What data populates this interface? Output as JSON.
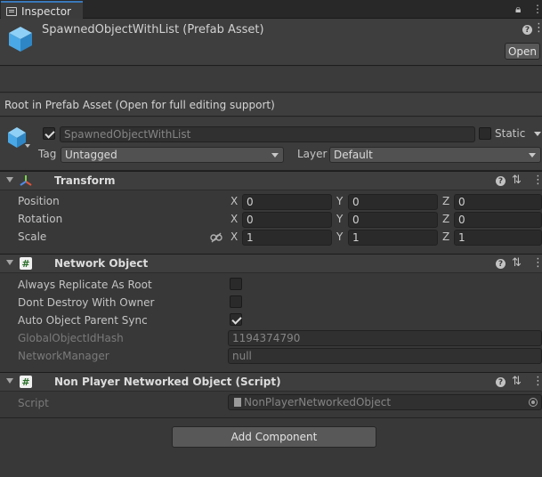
{
  "tab": {
    "label": "Inspector"
  },
  "header": {
    "title": "SpawnedObjectWithList (Prefab Asset)",
    "open_label": "Open"
  },
  "root_message": "Root in Prefab Asset (Open for full editing support)",
  "gameobject": {
    "active": true,
    "name": "SpawnedObjectWithList",
    "static_label": "Static",
    "static_checked": false,
    "tag_label": "Tag",
    "tag_value": "Untagged",
    "layer_label": "Layer",
    "layer_value": "Default"
  },
  "transform": {
    "title": "Transform",
    "rows": [
      {
        "label": "Position",
        "x": "0",
        "y": "0",
        "z": "0"
      },
      {
        "label": "Rotation",
        "x": "0",
        "y": "0",
        "z": "0"
      },
      {
        "label": "Scale",
        "x": "1",
        "y": "1",
        "z": "1"
      }
    ],
    "axis": {
      "x": "X",
      "y": "Y",
      "z": "Z"
    }
  },
  "network_object": {
    "title": "Network Object",
    "fields": {
      "always_replicate": {
        "label": "Always Replicate As Root",
        "checked": false
      },
      "dont_destroy": {
        "label": "Dont Destroy With Owner",
        "checked": false
      },
      "auto_parent": {
        "label": "Auto Object Parent Sync",
        "checked": true
      },
      "hash": {
        "label": "GlobalObjectIdHash",
        "value": "1194374790"
      },
      "manager": {
        "label": "NetworkManager",
        "value": "null"
      }
    }
  },
  "script_component": {
    "title": "Non Player Networked Object (Script)",
    "script_label": "Script",
    "script_value": "NonPlayerNetworkedObject"
  },
  "add_component_label": "Add Component",
  "icons": {
    "tab": "inspector-icon",
    "lock": "lock-icon",
    "menu": "kebab-menu-icon",
    "prefab": "prefab-cube-icon",
    "help": "help-icon",
    "presets": "presets-icon",
    "transform": "transform-axes-icon",
    "script": "cs-script-icon",
    "link": "constrain-proportions-icon"
  },
  "colors": {
    "accent": "#3a79bb",
    "background": "#383838",
    "prefab_blue": "#5ab4f0"
  }
}
